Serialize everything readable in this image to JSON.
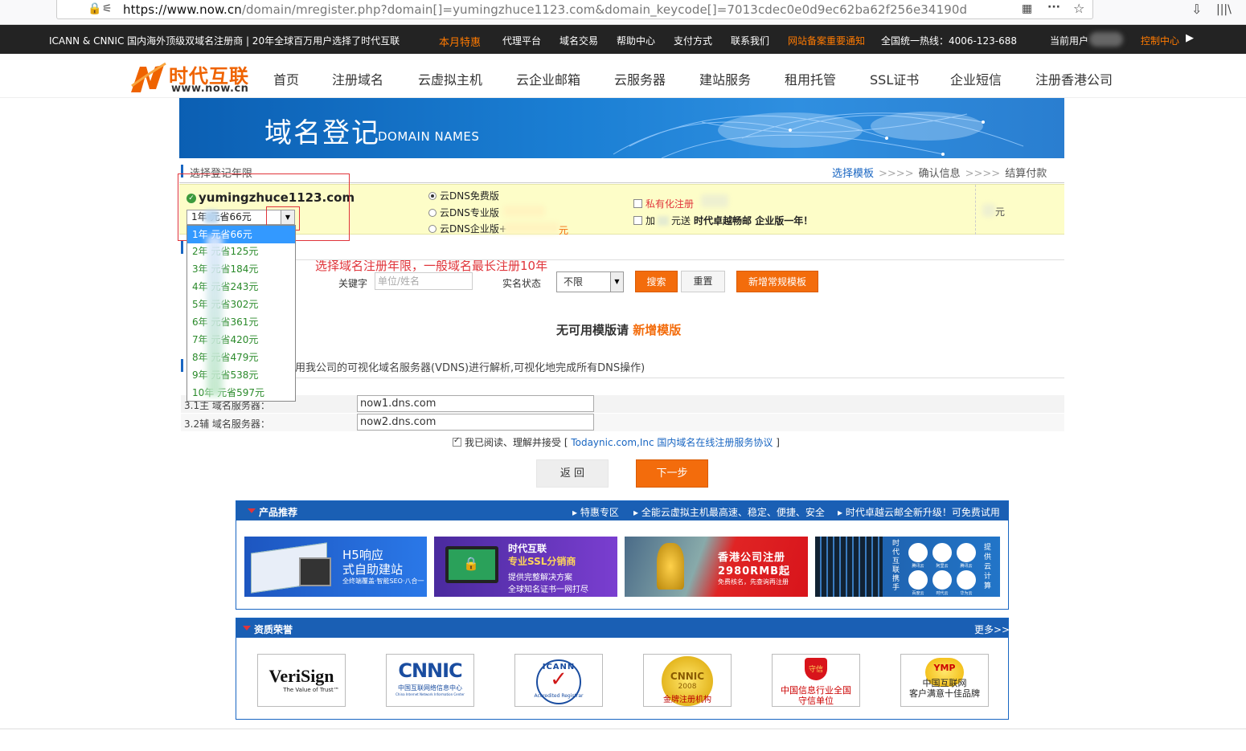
{
  "browser": {
    "url_host": "https://www.now.cn",
    "url_path": "/domain/mregister.php?domain[]=yumingzhuce1123.com&domain_keycode[]=7013cdec0e0d9ec62ba62f256e34190d"
  },
  "topbar": {
    "tagline": "ICANN & CNNIC 国内海外顶级双域名注册商 | 20年全球百万用户选择了时代互联",
    "links": [
      "本月特惠",
      "代理平台",
      "域名交易",
      "帮助中心",
      "支付方式",
      "联系我们",
      "网站备案重要通知"
    ],
    "hotline": "全国统一热线：4006-123-688",
    "current_user": "当前用户",
    "control": "控制中心"
  },
  "logo": {
    "cn": "时代互联",
    "en": "www.now.cn"
  },
  "nav": [
    "首页",
    "注册域名",
    "云虚拟主机",
    "云企业邮箱",
    "云服务器",
    "建站服务",
    "租用托管",
    "SSL证书",
    "企业短信",
    "注册香港公司"
  ],
  "banner": {
    "title": "域名登记",
    "subtitle": "DOMAIN NAMES"
  },
  "section1": {
    "label": "选择登记年限"
  },
  "steps": [
    "选择模板",
    "确认信息",
    "结算付款"
  ],
  "steps_arrow": ">>>>",
  "domain": {
    "name": "yumingzhuce1123.com",
    "year_selected": "1年    元省66元"
  },
  "dns_options": [
    "云DNS免费版",
    "云DNS专业版",
    "云DNS企业版+"
  ],
  "dns_suffix": "元",
  "extras": {
    "private": "私有化注册",
    "gift_prefix": "加",
    "gift_mid": "元送",
    "gift_bold": "时代卓越畅邮 企业版",
    "gift_suffix": "一年！"
  },
  "price_unit": "元",
  "year_options": [
    "1年    元省66元",
    "2年    元省125元",
    "3年    元省184元",
    "4年    元省243元",
    "5年    元省302元",
    "6年    元省361元",
    "7年    元省420元",
    "8年    元省479元",
    "9年    元省538元",
    "10年    元省597元"
  ],
  "hint": "选择域名注册年限，一般域名最长注册10年",
  "search": {
    "keyword_label": "关键字",
    "keyword_placeholder": "单位/姓名",
    "status_label": "实名状态",
    "status_value": "不限",
    "search_btn": "搜索",
    "reset_btn": "重置",
    "new_btn": "新增常规模板"
  },
  "no_template": {
    "text": "无可用模版请",
    "link": "新增模版"
  },
  "dns_desc": "用我公司的可视化域名服务器(VDNS)进行解析,可视化地完成所有DNS操作)",
  "dns_servers": [
    {
      "label": "3.1主 域名服务器：",
      "value": "now1.dns.com"
    },
    {
      "label": "3.2辅 域名服务器：",
      "value": "now2.dns.com"
    }
  ],
  "agree": {
    "prefix": "我已阅读、理解并接受 [",
    "link": "Todaynic.com,Inc 国内域名在线注册服务协议",
    "suffix": "]"
  },
  "buttons": {
    "back": "返 回",
    "next": "下一步"
  },
  "products": {
    "title": "产品推荐",
    "links": [
      "特惠专区",
      "全能云虚拟主机最高速、稳定、便捷、安全",
      "时代卓越云邮全新升级！可免费试用"
    ],
    "promo1": {
      "l1": "H5响应",
      "l2": "式自助建站",
      "l3": "全终端覆盖·智能SEO·八合一"
    },
    "promo2": {
      "l1": "时代互联",
      "l2": "专业SSL分销商",
      "l3": "提供完整解决方案",
      "l4": "全球知名证书一网打尽"
    },
    "promo3": {
      "l1": "香港公司注册",
      "l2": "2980RMB起",
      "l3": "免费核名，先查询再注册"
    },
    "promo4": {
      "left": "时代互联携手",
      "right": "提供云计算",
      "icons": [
        "腾讯云",
        "阿里云",
        "腾讯云",
        "百度云",
        "时代云",
        "华为云"
      ]
    }
  },
  "honors": {
    "title": "资质荣誉",
    "more": "更多>>",
    "verisign": {
      "name": "VeriSign",
      "tag": "The Value of Trust™"
    },
    "cnnic": {
      "name": "CNNIC",
      "sub": "中国互联网络信息中心",
      "en": "China Internet Network Information Center"
    },
    "icann": {
      "top": "ICANN",
      "bottom": "Accredited Registrar"
    },
    "cnnic2008": {
      "name": "CNNIC",
      "year": "2008",
      "sub": "金牌注册机构"
    },
    "shouxin": {
      "seal": "守信",
      "l1": "中国信息行业全国",
      "l2": "守信单位"
    },
    "ymp": {
      "seal": "YMP",
      "l1": "中国互联网",
      "l2": "客户满意十佳品牌"
    }
  },
  "colors": {
    "accent": "#1966c2",
    "orange": "#f36c0c",
    "highlight": "#fdfdc8",
    "red": "#e0343a"
  }
}
